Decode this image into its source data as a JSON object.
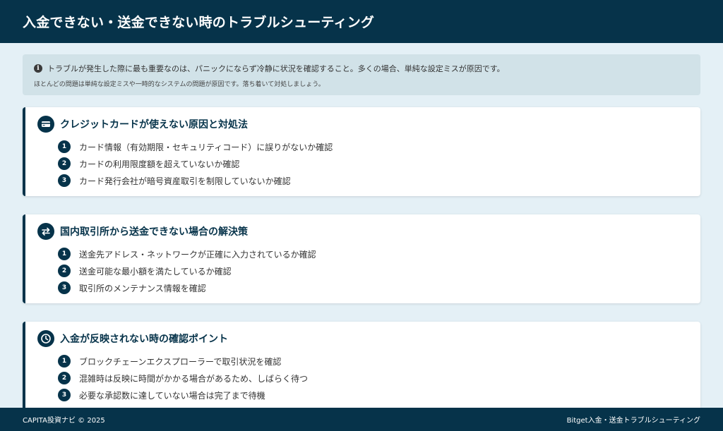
{
  "header": {
    "title": "入金できない・送金できない時のトラブルシューティング"
  },
  "notice": {
    "icon": "info-icon",
    "line1": "トラブルが発生した際に最も重要なのは、パニックにならず冷静に状況を確認すること。多くの場合、単純な設定ミスが原因です。",
    "line2": "ほとんどの問題は単純な設定ミスや一時的なシステムの問題が原因です。落ち着いて対処しましょう。"
  },
  "cards": [
    {
      "icon": "credit-card-icon",
      "title": "クレジットカードが使えない原因と対処法",
      "items": [
        {
          "num": "1",
          "text": "カード情報（有効期限・セキュリティコード）に誤りがないか確認"
        },
        {
          "num": "2",
          "text": "カードの利用限度額を超えていないか確認"
        },
        {
          "num": "3",
          "text": "カード発行会社が暗号資産取引を制限していないか確認"
        }
      ]
    },
    {
      "icon": "exchange-icon",
      "title": "国内取引所から送金できない場合の解決策",
      "items": [
        {
          "num": "1",
          "text": "送金先アドレス・ネットワークが正確に入力されているか確認"
        },
        {
          "num": "2",
          "text": "送金可能な最小額を満たしているか確認"
        },
        {
          "num": "3",
          "text": "取引所のメンテナンス情報を確認"
        }
      ]
    },
    {
      "icon": "clock-icon",
      "title": "入金が反映されない時の確認ポイント",
      "items": [
        {
          "num": "1",
          "text": "ブロックチェーンエクスプローラーで取引状況を確認"
        },
        {
          "num": "2",
          "text": "混雑時は反映に時間がかかる場合があるため、しばらく待つ"
        },
        {
          "num": "3",
          "text": "必要な承認数に達していない場合は完了まで待機"
        }
      ]
    }
  ],
  "footer": {
    "left": "CAPITA投資ナビ © 2025",
    "right": "Bitget入金・送金トラブルシューティング"
  },
  "colors": {
    "primary": "#06334a",
    "background": "#e4f0f6",
    "notice_bg": "#d1e2e8"
  }
}
